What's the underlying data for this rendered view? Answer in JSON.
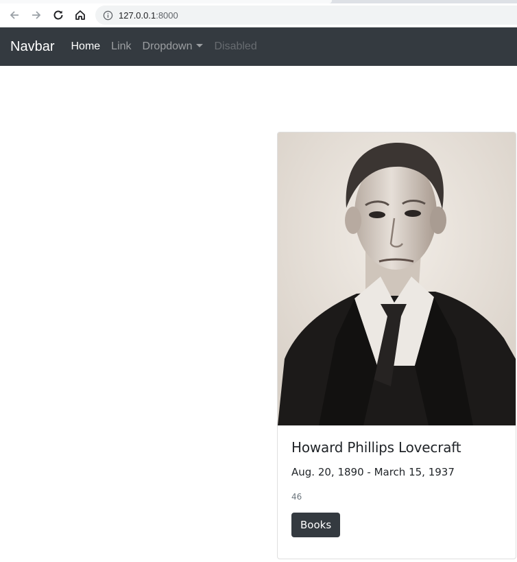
{
  "browser": {
    "url_host": "127.0.0.1",
    "url_port": ":8000",
    "back_icon": "arrow-left-icon",
    "forward_icon": "arrow-right-icon",
    "reload_icon": "reload-icon",
    "home_icon": "home-icon",
    "info_icon": "info-icon"
  },
  "navbar": {
    "brand": "Navbar",
    "links": [
      {
        "label": "Home",
        "state": "active"
      },
      {
        "label": "Link",
        "state": "normal"
      },
      {
        "label": "Dropdown",
        "state": "dropdown"
      },
      {
        "label": "Disabled",
        "state": "disabled"
      }
    ],
    "background": "#343a40"
  },
  "card": {
    "image_alt": "portrait photograph",
    "title": "Howard Phillips Lovecraft",
    "dates": "Aug. 20, 1890 - March 15, 1937",
    "count": "46",
    "button_label": "Books",
    "button_color": "#343a40"
  }
}
